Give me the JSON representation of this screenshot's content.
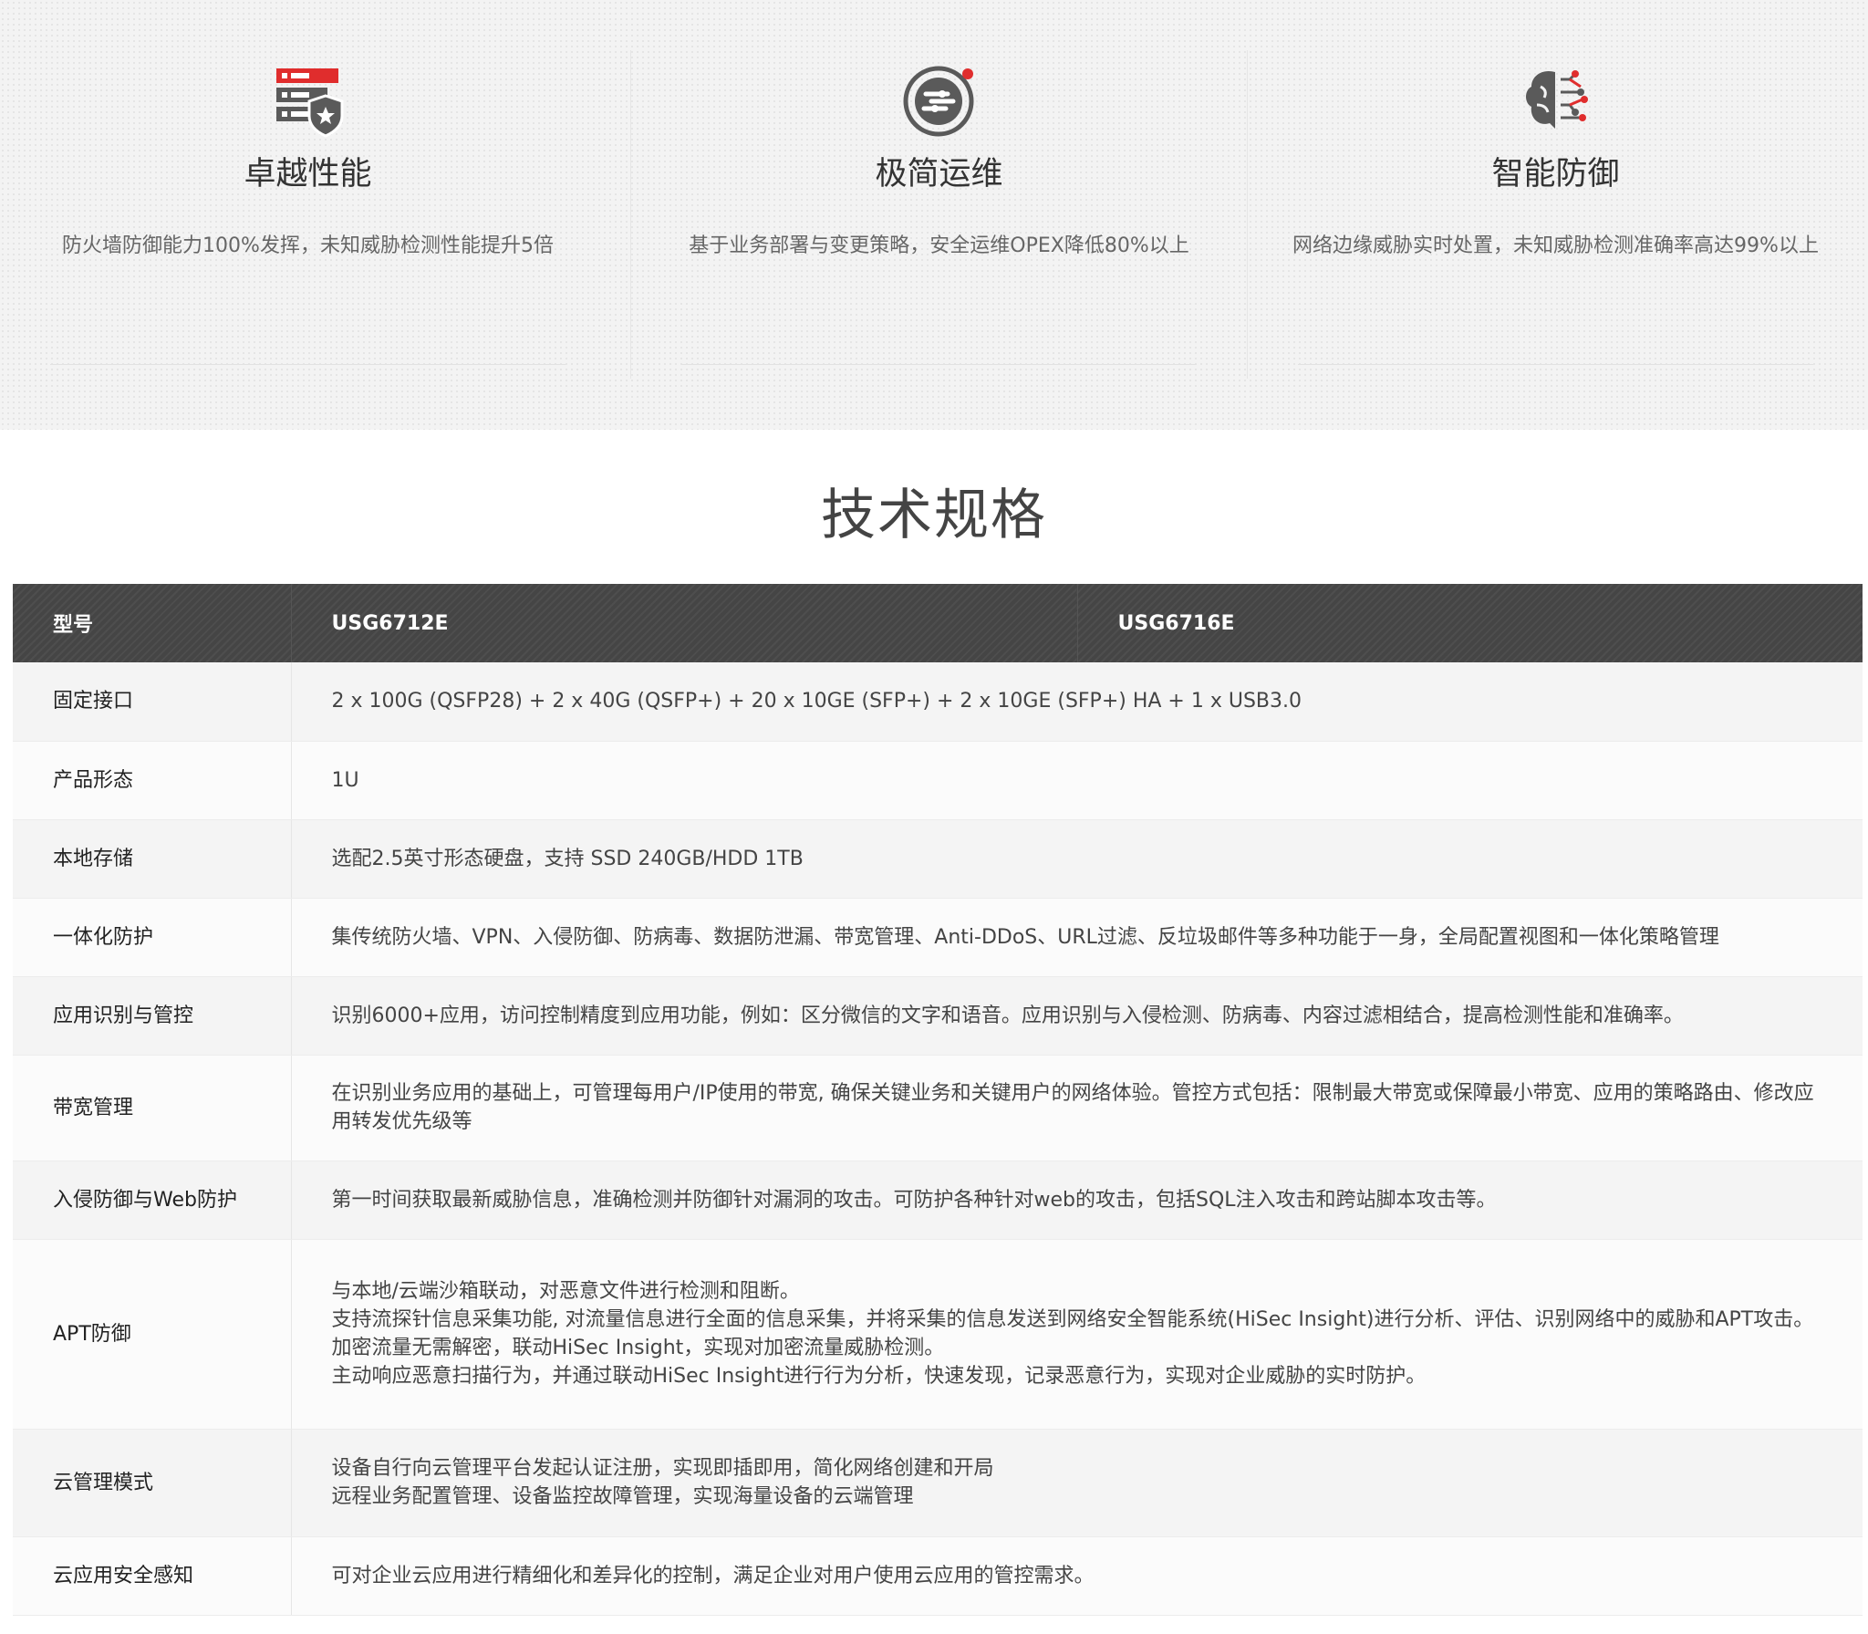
{
  "features": [
    {
      "title": "卓越性能",
      "desc": "防火墙防御能力100%发挥，未知威胁检测性能提升5倍",
      "icon": "server-shield-icon"
    },
    {
      "title": "极简运维",
      "desc": "基于业务部署与变更策略，安全运维OPEX降低80%以上",
      "icon": "simple-ops-icon"
    },
    {
      "title": "智能防御",
      "desc": "网络边缘威胁实时处置，未知威胁检测准确率高达99%以上",
      "icon": "ai-brain-icon"
    }
  ],
  "colors": {
    "accent": "#e02d2d",
    "header_bg": "#454545",
    "icon_gray": "#5a5a5a"
  },
  "spec": {
    "title": "技术规格",
    "header": {
      "col1": "型号",
      "col2": "USG6712E",
      "col3": "USG6716E"
    },
    "rows": [
      {
        "label": "固定接口",
        "lines": [
          "2 x 100G (QSFP28) + 2 x 40G (QSFP+) + 20 x 10GE (SFP+) + 2 x 10GE (SFP+) HA + 1 x USB3.0"
        ]
      },
      {
        "label": "产品形态",
        "lines": [
          "1U"
        ]
      },
      {
        "label": "本地存储",
        "lines": [
          "选配2.5英寸形态硬盘，支持 SSD 240GB/HDD 1TB"
        ]
      },
      {
        "label": "一体化防护",
        "lines": [
          "集传统防火墙、VPN、入侵防御、防病毒、数据防泄漏、带宽管理、Anti-DDoS、URL过滤、反垃圾邮件等多种功能于一身，全局配置视图和一体化策略管理"
        ]
      },
      {
        "label": "应用识别与管控",
        "lines": [
          "识别6000+应用，访问控制精度到应用功能，例如：区分微信的文字和语音。应用识别与入侵检测、防病毒、内容过滤相结合，提高检测性能和准确率。"
        ]
      },
      {
        "label": "带宽管理",
        "lines": [
          "在识别业务应用的基础上，可管理每用户/IP使用的带宽, 确保关键业务和关键用户的网络体验。管控方式包括：限制最大带宽或保障最小带宽、应用的策略路由、修改应用转发优先级等"
        ]
      },
      {
        "label": "入侵防御与Web防护",
        "lines": [
          "第一时间获取最新威胁信息，准确检测并防御针对漏洞的攻击。可防护各种针对web的攻击，包括SQL注入攻击和跨站脚本攻击等。"
        ]
      },
      {
        "label": "APT防御",
        "lines": [
          "与本地/云端沙箱联动，对恶意文件进行检测和阻断。",
          "支持流探针信息采集功能, 对流量信息进行全面的信息采集，并将采集的信息发送到网络安全智能系统(HiSec Insight)进行分析、评估、识别网络中的威胁和APT攻击。",
          "加密流量无需解密，联动HiSec Insight，实现对加密流量威胁检测。",
          "主动响应恶意扫描行为，并通过联动HiSec Insight进行行为分析，快速发现，记录恶意行为，实现对企业威胁的实时防护。"
        ]
      },
      {
        "label": "云管理模式",
        "lines": [
          "设备自行向云管理平台发起认证注册，实现即插即用，简化网络创建和开局",
          "远程业务配置管理、设备监控故障管理，实现海量设备的云端管理"
        ]
      },
      {
        "label": "云应用安全感知",
        "lines": [
          "可对企业云应用进行精细化和差异化的控制，满足企业对用户使用云应用的管控需求。"
        ]
      }
    ]
  }
}
